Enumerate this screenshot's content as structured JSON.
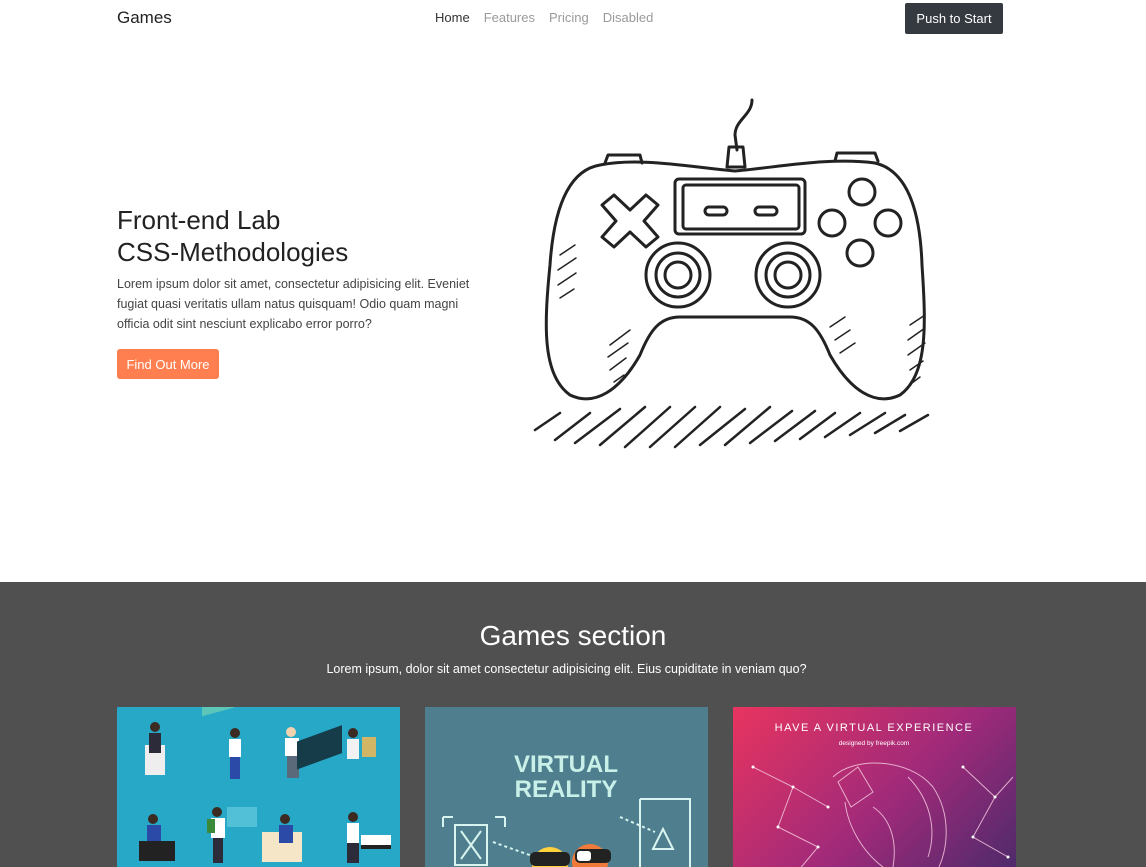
{
  "navbar": {
    "brand": "Games",
    "links": [
      {
        "label": "Home",
        "active": true
      },
      {
        "label": "Features",
        "active": false
      },
      {
        "label": "Pricing",
        "active": false
      },
      {
        "label": "Disabled",
        "active": false
      }
    ],
    "cta_label": "Push to Start"
  },
  "hero": {
    "title_line1": "Front-end Lab",
    "title_line2": "CSS-Methodologies",
    "text": "Lorem ipsum dolor sit amet, consectetur adipisicing elit. Eveniet fugiat quasi veritatis ullam natus quisquam! Odio quam magni officia odit sint nesciunt explicabo error porro?",
    "button_label": "Find Out More",
    "illustration_icon": "gamepad-sketch-icon"
  },
  "games_section": {
    "title": "Games section",
    "subtitle": "Lorem ipsum, dolor sit amet consectetur adipisicing elit. Eius cupiditate in veniam quo?",
    "cards": [
      {
        "image_icon": "isometric-people-icon"
      },
      {
        "image_icon": "virtual-reality-icon",
        "image_text_line1": "VIRTUAL",
        "image_text_line2": "REALITY"
      },
      {
        "image_icon": "vr-headset-woman-icon",
        "image_text_line1": "HAVE A VIRTUAL EXPERIENCE",
        "image_text_line2": "designed by freepik.com"
      }
    ]
  },
  "colors": {
    "accent": "#ff7f50",
    "dark_button": "#343a40",
    "section_bg": "#505050"
  }
}
